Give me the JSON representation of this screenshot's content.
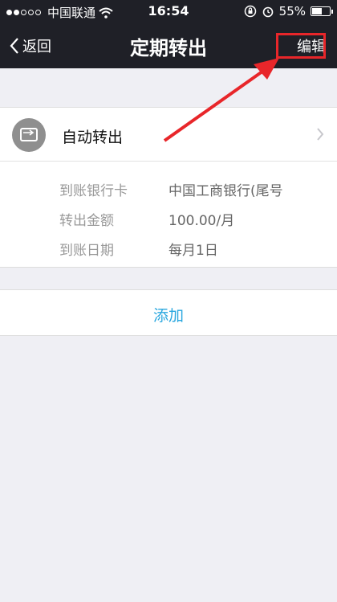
{
  "status": {
    "carrier": "中国联通",
    "time": "16:54",
    "battery_text": "55%",
    "battery_level": 0.55
  },
  "nav": {
    "back_label": "返回",
    "title": "定期转出",
    "edit_label": "编辑"
  },
  "auto": {
    "label": "自动转出",
    "details": [
      {
        "label": "到账银行卡",
        "value": "中国工商银行(尾号"
      },
      {
        "label": "转出金额",
        "value": "100.00/月"
      },
      {
        "label": "到账日期",
        "value": "每月1日"
      }
    ]
  },
  "add_label": "添加",
  "colors": {
    "nav_bg": "#1f2027",
    "accent": "#2aa7df",
    "highlight": "#e8262a"
  },
  "icons": [
    "wifi-icon",
    "lock-rotation-icon",
    "alarm-icon",
    "battery-icon",
    "back-chevron-icon",
    "card-transfer-icon",
    "chevron-right-icon",
    "red-arrow-annotation"
  ]
}
